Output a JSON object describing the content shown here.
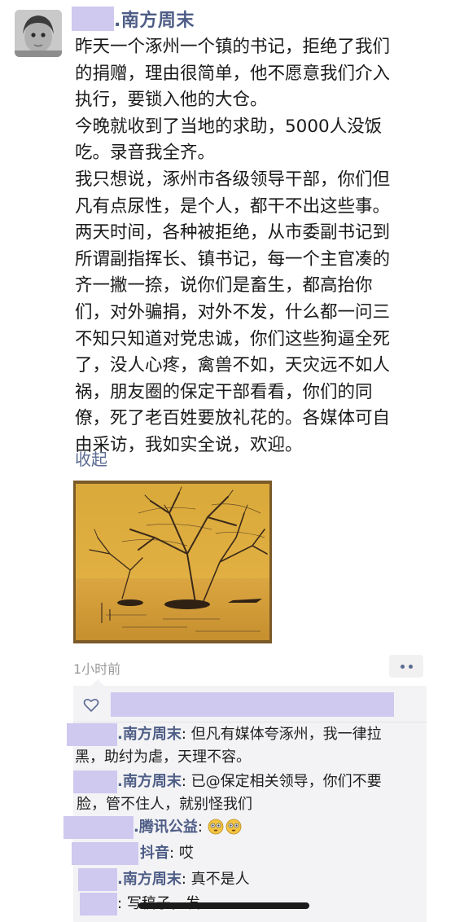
{
  "post": {
    "author_name": ".南方周末",
    "body_lines": [
      "昨天一个涿州一个镇的书记，拒绝了我们",
      "的捐赠，理由很简单，他不愿意我们介入",
      "执行，要锁入他的大仓。",
      "今晚就收到了当地的求助，5000人没饭",
      "吃。录音我全齐。",
      "我只想说，涿州市各级领导干部，你们但",
      "凡有点尿性，是个人，都干不出这些事。",
      "两天时间，各种被拒绝，从市委副书记到",
      "所谓副指挥长、镇书记，每一个主官凑的",
      "齐一撇一捺，说你们是畜生，都高抬你",
      "们，对外骗捐，对外不发，什么都一问三",
      "不知只知道对党忠诚，你们这些狗逼全死",
      "了，没人心疼，禽兽不如，天灾远不如人",
      "祸，朋友圈的保定干部看看，你们的同",
      "僚，死了老百姓要放礼花的。各媒体可自",
      "由采访，我如实全说，欢迎。"
    ],
    "collapse_label": "收起",
    "time": "1小时前",
    "more_icon": "more-dots-icon"
  },
  "comments": [
    {
      "author": ".南方周末",
      "line1": "但凡有媒体夸涿州，我一律拉",
      "line2": "黑，助纣为虐，天理不容。"
    },
    {
      "author": ".南方周末",
      "line1": "已@保定相关领导，你们不要",
      "line2": "脸，管不住人，就别怪我们"
    },
    {
      "author": ".腾讯公益",
      "text": "",
      "emoji": [
        "flushed-face-icon",
        "flushed-face-icon"
      ]
    },
    {
      "author": "抖音",
      "text": "哎"
    },
    {
      "author": ".南方周末",
      "text": "真不是人"
    },
    {
      "author": "",
      "text": "写稿子，发"
    }
  ],
  "colors": {
    "name_blue": "#4e5d86",
    "redaction": "#cfc8ef",
    "comment_bg": "#f3f3f5"
  }
}
